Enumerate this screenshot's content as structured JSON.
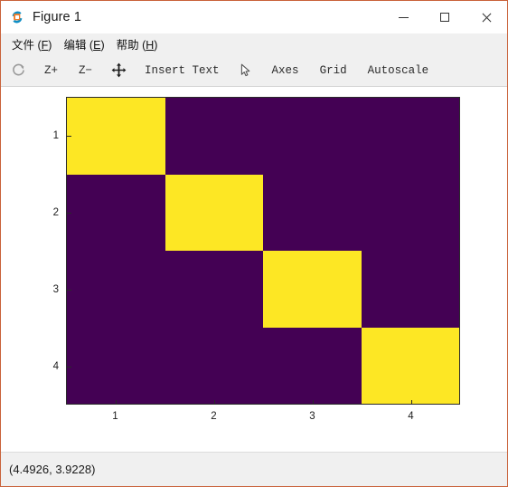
{
  "window": {
    "title": "Figure 1",
    "icon": "octave-logo-icon",
    "border_color": "#c9623a",
    "controls": [
      {
        "name": "minimize-button",
        "label": "—"
      },
      {
        "name": "maximize-button",
        "label": "□"
      },
      {
        "name": "close-button",
        "label": "✕"
      }
    ]
  },
  "menubar": {
    "items": [
      {
        "name": "menu-file",
        "text": "文件 (",
        "accel": "F",
        "tail": ")"
      },
      {
        "name": "menu-edit",
        "text": "编辑 (",
        "accel": "E",
        "tail": ")"
      },
      {
        "name": "menu-help",
        "text": "帮助 (",
        "accel": "H",
        "tail": ")"
      }
    ]
  },
  "toolbar": {
    "items": [
      {
        "name": "reset-view-button",
        "type": "icon",
        "icon": "circular-arrow-icon",
        "label": ""
      },
      {
        "name": "zoom-in-button",
        "type": "label",
        "label": "Z+"
      },
      {
        "name": "zoom-out-button",
        "type": "label",
        "label": "Z−"
      },
      {
        "name": "pan-button",
        "type": "icon",
        "icon": "move-cross-icon",
        "label": ""
      },
      {
        "name": "insert-text-button",
        "type": "label",
        "label": "Insert Text"
      },
      {
        "name": "select-button",
        "type": "icon",
        "icon": "cursor-arrow-icon",
        "label": ""
      },
      {
        "name": "axes-button",
        "type": "label",
        "label": "Axes"
      },
      {
        "name": "grid-button",
        "type": "label",
        "label": "Grid"
      },
      {
        "name": "autoscale-button",
        "type": "label",
        "label": "Autoscale"
      }
    ]
  },
  "statusbar": {
    "coordinates": "(4.4926, 3.9228)"
  },
  "chart_data": {
    "type": "heatmap",
    "title": "",
    "xlabel": "",
    "ylabel": "",
    "x_tick_labels": [
      "1",
      "2",
      "3",
      "4"
    ],
    "y_tick_labels": [
      "1",
      "2",
      "3",
      "4"
    ],
    "xlim": [
      0.5,
      4.5
    ],
    "ylim": [
      0.5,
      4.5
    ],
    "y_axis_direction": "reversed",
    "grid": false,
    "legend": "none",
    "colormap": "viridis",
    "color_low": "#440154",
    "color_high": "#fde724",
    "vmin": 0,
    "vmax": 1,
    "rows": 4,
    "cols": 4,
    "matrix": [
      [
        1,
        0,
        0,
        0
      ],
      [
        0,
        1,
        0,
        0
      ],
      [
        0,
        0,
        1,
        0
      ],
      [
        0,
        0,
        0,
        1
      ]
    ],
    "description": "4x4 identity matrix rendered with viridis colormap"
  }
}
